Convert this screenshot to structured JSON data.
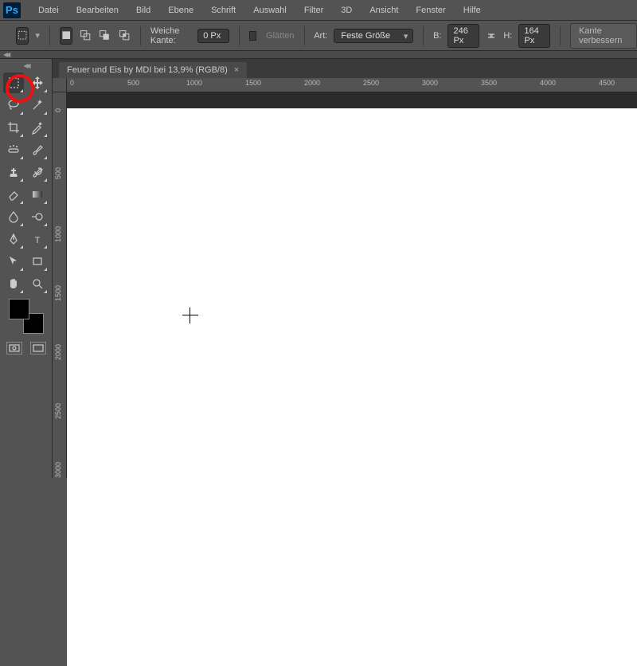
{
  "logo": "Ps",
  "menu": [
    "Datei",
    "Bearbeiten",
    "Bild",
    "Ebene",
    "Schrift",
    "Auswahl",
    "Filter",
    "3D",
    "Ansicht",
    "Fenster",
    "Hilfe"
  ],
  "options": {
    "feather_label": "Weiche Kante:",
    "feather_value": "0 Px",
    "antialias_label": "Glätten",
    "style_label": "Art:",
    "style_value": "Feste Größe",
    "width_label": "B:",
    "width_value": "246 Px",
    "height_label": "H:",
    "height_value": "164 Px",
    "refine_label": "Kante verbessern"
  },
  "tab": {
    "title": "Feuer und Eis by MDI bei 13,9% (RGB/8)",
    "close": "×"
  },
  "ruler_h": [
    "0",
    "500",
    "1000",
    "1500",
    "2000",
    "2500",
    "3000",
    "3500",
    "4000",
    "4500"
  ],
  "ruler_v": [
    "0",
    "500",
    "1000",
    "1500",
    "2000",
    "2500",
    "3000"
  ],
  "colors": {
    "fg": "#000000",
    "bg": "#000000"
  }
}
